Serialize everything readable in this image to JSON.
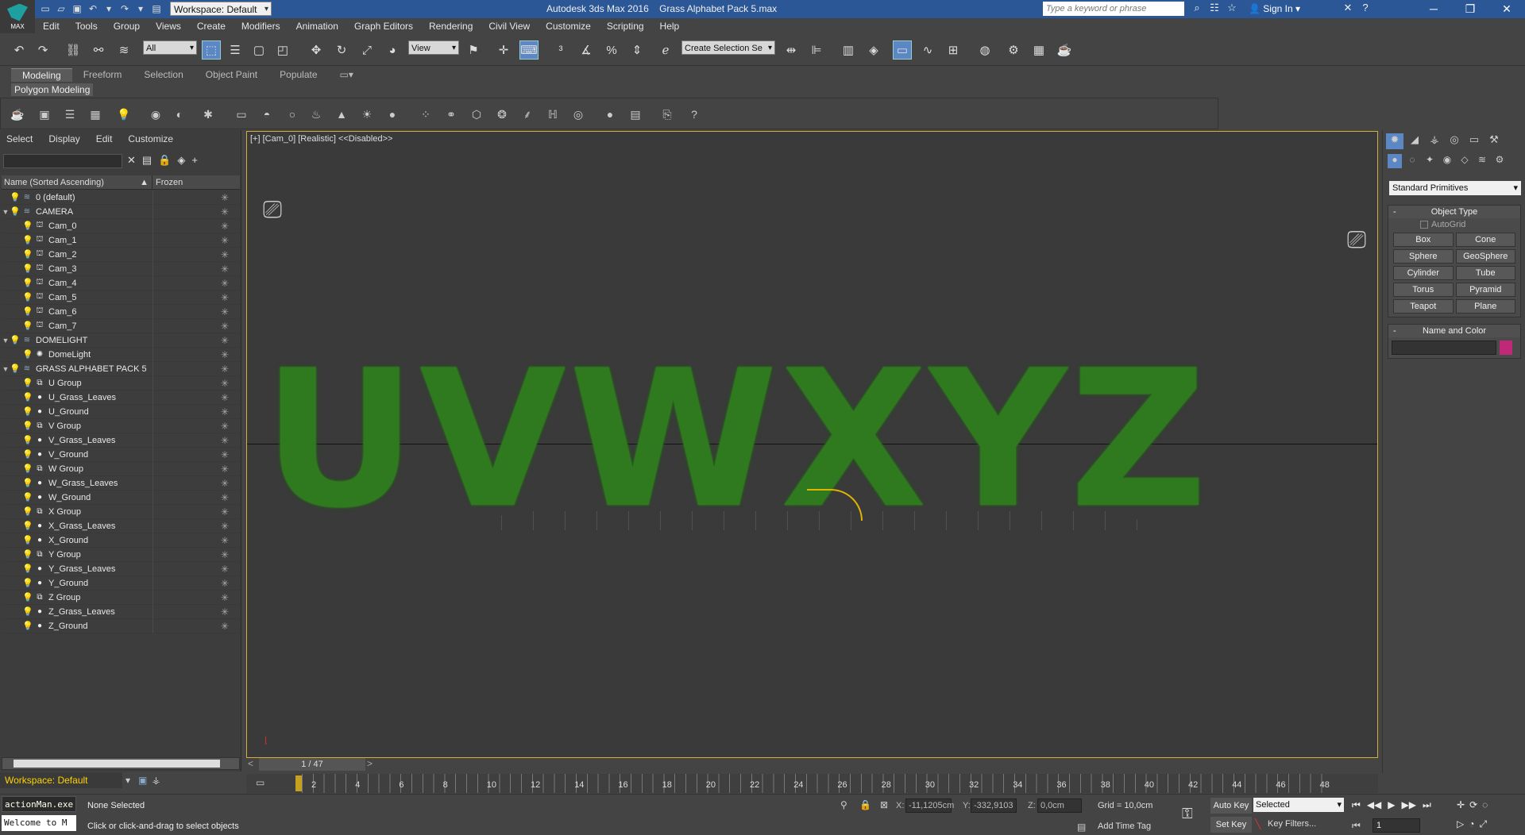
{
  "app": {
    "title": "Autodesk 3ds Max 2016",
    "file": "Grass Alphabet Pack 5.max",
    "logo": "MAX",
    "workspace": "Workspace: Default",
    "search_placeholder": "Type a keyword or phrase",
    "sign_in": "Sign In"
  },
  "menu": [
    "Edit",
    "Tools",
    "Group",
    "Views",
    "Create",
    "Modifiers",
    "Animation",
    "Graph Editors",
    "Rendering",
    "Civil View",
    "Customize",
    "Scripting",
    "Help"
  ],
  "toolbar": {
    "filter": "All",
    "view": "View",
    "selection_set": "Create Selection Se"
  },
  "ribbon": {
    "tabs": [
      "Modeling",
      "Freeform",
      "Selection",
      "Object Paint",
      "Populate"
    ],
    "sub": "Polygon Modeling"
  },
  "explorer": {
    "menu": [
      "Select",
      "Display",
      "Edit",
      "Customize"
    ],
    "col1": "Name (Sorted Ascending)",
    "col2": "Frozen",
    "rows": [
      {
        "name": "0 (default)",
        "level": 0,
        "type": "layer"
      },
      {
        "name": "CAMERA",
        "level": 0,
        "type": "layer"
      },
      {
        "name": "Cam_0",
        "level": 1,
        "type": "cam"
      },
      {
        "name": "Cam_1",
        "level": 1,
        "type": "cam"
      },
      {
        "name": "Cam_2",
        "level": 1,
        "type": "cam"
      },
      {
        "name": "Cam_3",
        "level": 1,
        "type": "cam"
      },
      {
        "name": "Cam_4",
        "level": 1,
        "type": "cam"
      },
      {
        "name": "Cam_5",
        "level": 1,
        "type": "cam"
      },
      {
        "name": "Cam_6",
        "level": 1,
        "type": "cam"
      },
      {
        "name": "Cam_7",
        "level": 1,
        "type": "cam"
      },
      {
        "name": "DOMELIGHT",
        "level": 0,
        "type": "layer"
      },
      {
        "name": "DomeLight",
        "level": 1,
        "type": "light"
      },
      {
        "name": "GRASS ALPHABET PACK 5",
        "level": 0,
        "type": "layer"
      },
      {
        "name": "U Group",
        "level": 1,
        "type": "group"
      },
      {
        "name": "U_Grass_Leaves",
        "level": 1,
        "type": "obj"
      },
      {
        "name": "U_Ground",
        "level": 1,
        "type": "obj"
      },
      {
        "name": "V Group",
        "level": 1,
        "type": "group"
      },
      {
        "name": "V_Grass_Leaves",
        "level": 1,
        "type": "obj"
      },
      {
        "name": "V_Ground",
        "level": 1,
        "type": "obj"
      },
      {
        "name": "W Group",
        "level": 1,
        "type": "group"
      },
      {
        "name": "W_Grass_Leaves",
        "level": 1,
        "type": "obj"
      },
      {
        "name": "W_Ground",
        "level": 1,
        "type": "obj"
      },
      {
        "name": "X Group",
        "level": 1,
        "type": "group"
      },
      {
        "name": "X_Grass_Leaves",
        "level": 1,
        "type": "obj"
      },
      {
        "name": "X_Ground",
        "level": 1,
        "type": "obj"
      },
      {
        "name": "Y Group",
        "level": 1,
        "type": "group"
      },
      {
        "name": "Y_Grass_Leaves",
        "level": 1,
        "type": "obj"
      },
      {
        "name": "Y_Ground",
        "level": 1,
        "type": "obj"
      },
      {
        "name": "Z Group",
        "level": 1,
        "type": "group"
      },
      {
        "name": "Z_Grass_Leaves",
        "level": 1,
        "type": "obj"
      },
      {
        "name": "Z_Ground",
        "level": 1,
        "type": "obj"
      }
    ]
  },
  "viewport": {
    "label": "[+] [Cam_0] [Realistic]  <<Disabled>>",
    "letters": [
      "U",
      "V",
      "W",
      "X",
      "Y",
      "Z"
    ],
    "frame": "1 / 47"
  },
  "command_panel": {
    "dropdown": "Standard Primitives",
    "object_type": "Object Type",
    "autogrid": "AutoGrid",
    "buttons": [
      "Box",
      "Cone",
      "Sphere",
      "GeoSphere",
      "Cylinder",
      "Tube",
      "Torus",
      "Pyramid",
      "Teapot",
      "Plane"
    ],
    "name_color": "Name and Color"
  },
  "timeline": {
    "ticks": [
      "2",
      "4",
      "6",
      "8",
      "10",
      "12",
      "14",
      "16",
      "18",
      "20",
      "22",
      "24",
      "26",
      "28",
      "30",
      "32",
      "34",
      "36",
      "38",
      "40",
      "42",
      "44",
      "46",
      "48"
    ]
  },
  "status": {
    "maxscript1": "actionMan.exe",
    "maxscript2": "Welcome to M",
    "selection": "None Selected",
    "prompt": "Click or click-and-drag to select objects",
    "x": "-11,1205cm",
    "y": "-332,9103",
    "z": "0,0cm",
    "grid": "Grid = 10,0cm",
    "add_time_tag": "Add Time Tag",
    "auto_key": "Auto Key",
    "set_key": "Set Key",
    "selected": "Selected",
    "key_filters": "Key Filters...",
    "frame": "1"
  },
  "workspace_bar": "Workspace: Default"
}
